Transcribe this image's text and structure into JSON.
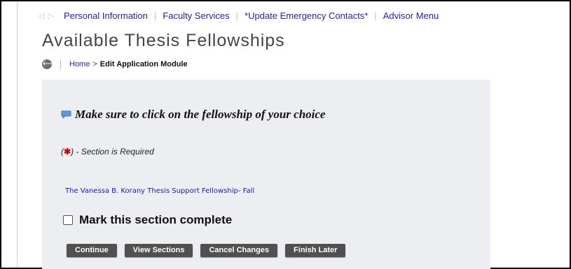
{
  "top_nav": {
    "items": [
      "Personal Information",
      "Faculty Services",
      "*Update Emergency Contacts*",
      "Advisor Menu"
    ],
    "separator": "|"
  },
  "page": {
    "title": "Available Thesis Fellowships"
  },
  "breadcrumb": {
    "home": "Home",
    "separator": ">",
    "current": "Edit Application Module"
  },
  "main": {
    "notice": "Make sure to click on the fellowship of your choice",
    "required_open": "(",
    "required_star": "✱",
    "required_rest": ") - Section is Required",
    "fellowship_link": "The Vanessa B. Korany Thesis Support Fellowship- Fall",
    "complete_label": "Mark this section complete"
  },
  "buttons": {
    "continue": "Continue",
    "view_sections": "View Sections",
    "cancel_changes": "Cancel Changes",
    "finish_later": "Finish Later"
  },
  "icons": {
    "prev": "◁",
    "next": "▷",
    "back": "🡐"
  },
  "colors": {
    "link": "#2222aa",
    "required": "#cc0000",
    "button": "#505050",
    "panel": "#eceef2"
  }
}
